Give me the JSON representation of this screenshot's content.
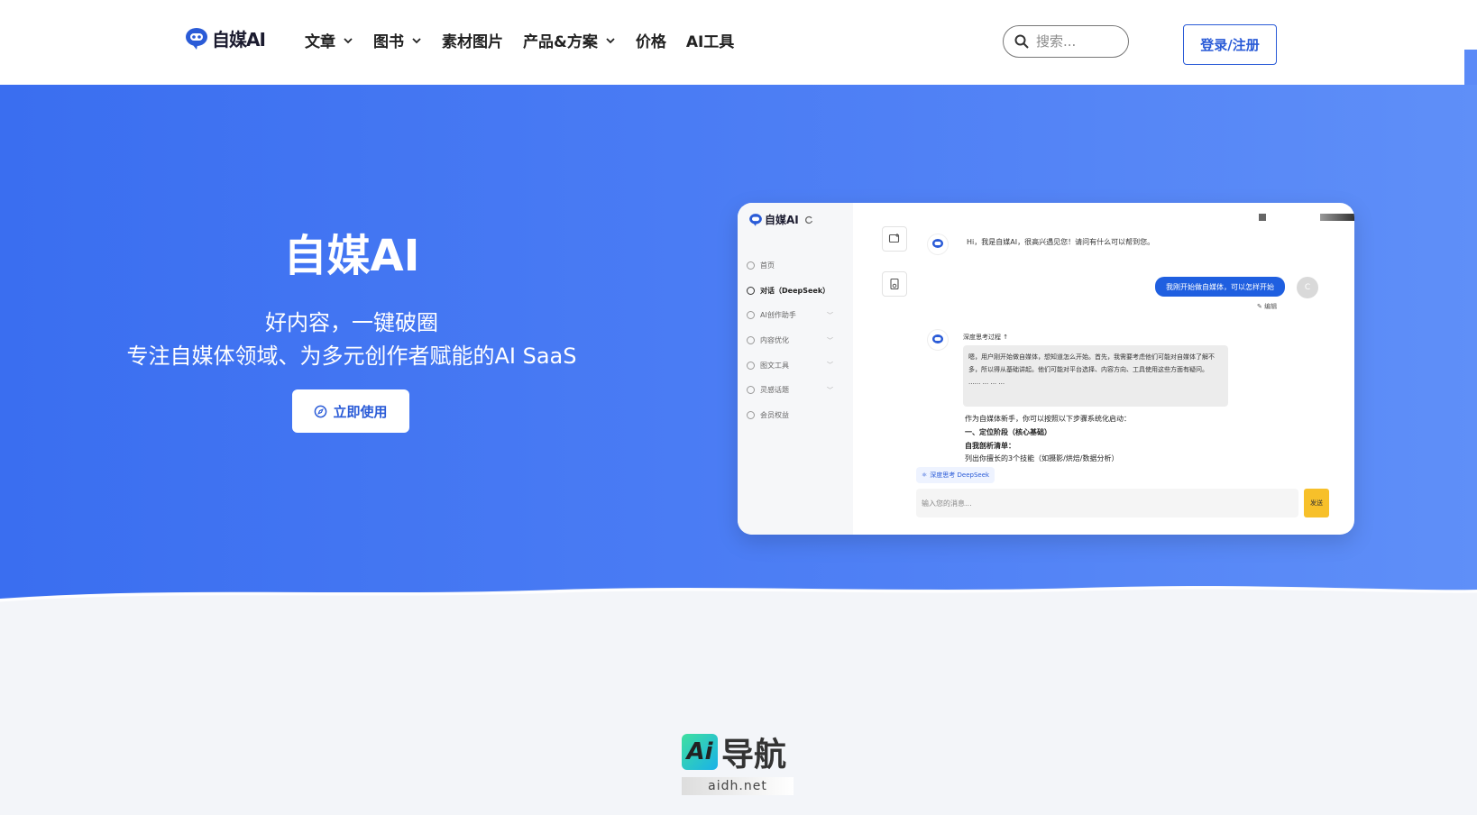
{
  "header": {
    "logo_text": "自媒AI",
    "nav": [
      {
        "label": "文章",
        "dropdown": true
      },
      {
        "label": "图书",
        "dropdown": true
      },
      {
        "label": "素材图片",
        "dropdown": false
      },
      {
        "label": "产品&方案",
        "dropdown": true
      },
      {
        "label": "价格",
        "dropdown": false
      },
      {
        "label": "AI工具",
        "dropdown": false
      }
    ],
    "search_placeholder": "搜索...",
    "login_label": "登录/注册"
  },
  "hero": {
    "title": "自媒AI",
    "subtitle1": "好内容，一键破圈",
    "subtitle2": "专注自媒体领域、为多元创作者赋能的AI SaaS",
    "cta_label": "立即使用"
  },
  "mockup": {
    "logo_text": "自媒AI",
    "menu": [
      {
        "label": "首页",
        "active": false,
        "caret": false
      },
      {
        "label": "对话（DeepSeek）",
        "active": true,
        "caret": false
      },
      {
        "label": "AI创作助手",
        "active": false,
        "caret": true
      },
      {
        "label": "内容优化",
        "active": false,
        "caret": true
      },
      {
        "label": "图文工具",
        "active": false,
        "caret": true
      },
      {
        "label": "灵感话题",
        "active": false,
        "caret": true
      },
      {
        "label": "会员权益",
        "active": false,
        "caret": false
      }
    ],
    "bot_greeting": "Hi，我是自媒AI，很高兴遇见您！请问有什么可以帮到您。",
    "user_message": "我刚开始做自媒体，可以怎样开始",
    "user_avatar": "C",
    "edit_label": "编辑",
    "think_label": "深度思考过程 ↑",
    "think_text": "嗯，用户刚开始做自媒体，想知道怎么开始。首先，我需要考虑他们可能对自媒体了解不多，所以得从基础讲起。他们可能对平台选择、内容方向、工具使用这些方面有疑问。",
    "think_ellipsis": "...... ... ... ...",
    "answer_lines": [
      {
        "text": "作为自媒体新手，你可以按照以下步骤系统化启动：",
        "bold": false
      },
      {
        "text": "一、定位阶段（核心基础）",
        "bold": true
      },
      {
        "text": "自我剖析清单：",
        "bold": true
      },
      {
        "text": "列出你擅长的3个技能（如摄影/烘焙/数据分析）",
        "bold": false
      }
    ],
    "deep_chip": "深度思考 DeepSeek",
    "input_placeholder": "输入您的消息...",
    "send_label": "发送"
  },
  "watermark": {
    "badge": "Ai",
    "text": "导航",
    "sub": "aidh.net"
  },
  "colors": {
    "brand_blue": "#2a5bd7",
    "hero_blue": "#3a6ef0",
    "send_yellow": "#f7c02a"
  }
}
